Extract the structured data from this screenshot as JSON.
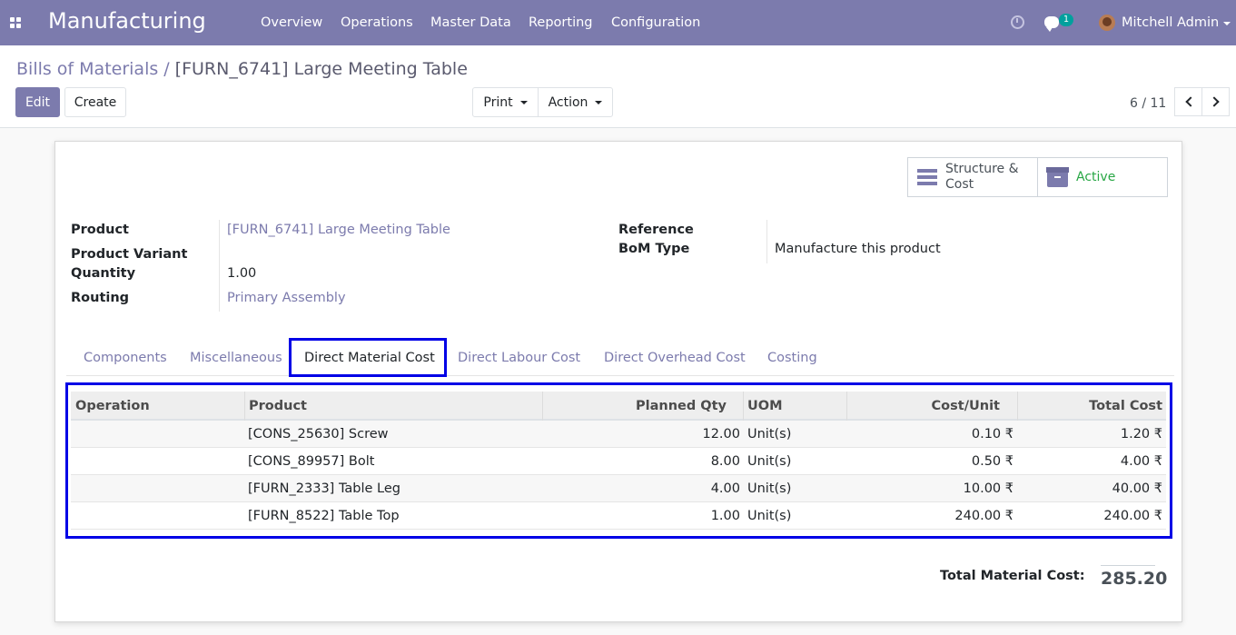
{
  "navbar": {
    "brand": "Manufacturing",
    "menu": [
      "Overview",
      "Operations",
      "Master Data",
      "Reporting",
      "Configuration"
    ],
    "chat_count": "1",
    "user": "Mitchell Admin"
  },
  "breadcrumb": {
    "parent": "Bills of Materials",
    "separator": "/",
    "current": "[FURN_6741] Large Meeting Table"
  },
  "buttons": {
    "edit": "Edit",
    "create": "Create",
    "print": "Print",
    "action": "Action"
  },
  "pager": {
    "value": "6 / 11"
  },
  "smart_buttons": {
    "structure_line1": "Structure &",
    "structure_line2": "Cost",
    "active": "Active"
  },
  "fields": {
    "product_label": "Product",
    "product_value": "[FURN_6741] Large Meeting Table",
    "variant_label": "Product Variant",
    "quantity_label": "Quantity",
    "quantity_value": "1.00",
    "routing_label": "Routing",
    "routing_value": "Primary Assembly",
    "reference_label": "Reference",
    "bom_type_label": "BoM Type",
    "bom_type_value": "Manufacture this product"
  },
  "tabs": [
    "Components",
    "Miscellaneous",
    "Direct Material Cost",
    "Direct Labour Cost",
    "Direct Overhead Cost",
    "Costing"
  ],
  "active_tab": "Direct Material Cost",
  "table": {
    "headers": [
      "Operation",
      "Product",
      "Planned Qty",
      "UOM",
      "Cost/Unit",
      "Total Cost"
    ],
    "rows": [
      {
        "operation": "",
        "product": "[CONS_25630] Screw",
        "qty": "12.00",
        "uom": "Unit(s)",
        "cost_unit": "0.10 ₹",
        "total": "1.20 ₹"
      },
      {
        "operation": "",
        "product": "[CONS_89957] Bolt",
        "qty": "8.00",
        "uom": "Unit(s)",
        "cost_unit": "0.50 ₹",
        "total": "4.00 ₹"
      },
      {
        "operation": "",
        "product": "[FURN_2333] Table Leg",
        "qty": "4.00",
        "uom": "Unit(s)",
        "cost_unit": "10.00 ₹",
        "total": "40.00 ₹"
      },
      {
        "operation": "",
        "product": "[FURN_8522] Table Top",
        "qty": "1.00",
        "uom": "Unit(s)",
        "cost_unit": "240.00 ₹",
        "total": "240.00 ₹"
      }
    ]
  },
  "total": {
    "label": "Total Material Cost:",
    "value": "285.20"
  },
  "colors": {
    "brand": "#7c7bad",
    "highlight": "#0000e6",
    "active_green": "#28a745"
  }
}
